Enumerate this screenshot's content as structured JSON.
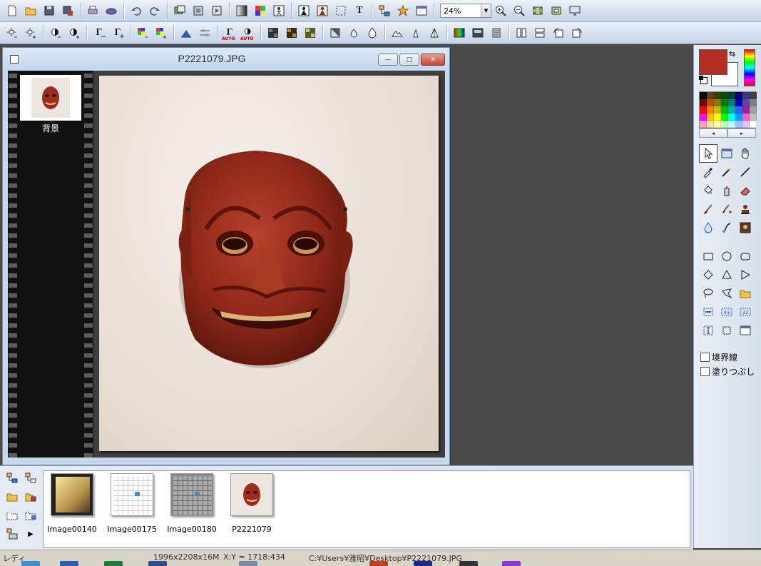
{
  "toolbar_main": {
    "zoom_value": "24%",
    "text_tool_label": "T",
    "buttons": [
      "new-file",
      "open-file",
      "save-file",
      "save-as",
      "print",
      "scan",
      "undo",
      "redo",
      "copy-image",
      "paste-image",
      "paste-new",
      "gradient",
      "color-balance",
      "figure",
      "select-person",
      "person-cut",
      "select-rect",
      "text",
      "tree",
      "effects",
      "window-mode"
    ]
  },
  "toolbar_adjust": {
    "gamma_label": "Γ",
    "auto_label": "AUTO"
  },
  "image_window": {
    "title": "P2221079.JPG",
    "min_label": "—",
    "max_label": "□",
    "close_label": "✕",
    "layer_name": "背景"
  },
  "tool_panel": {
    "foreground_color": "#b22f22",
    "background_color": "#ffffff",
    "palette": [
      "#000000",
      "#6b3b1c",
      "#3f3f00",
      "#005000",
      "#004040",
      "#000080",
      "#3a3a8a",
      "#404040",
      "#7f0000",
      "#c05000",
      "#7f7f00",
      "#008000",
      "#008080",
      "#0000c0",
      "#6b3fa0",
      "#808080",
      "#ff0000",
      "#ff8000",
      "#c0c000",
      "#00c000",
      "#00b0b0",
      "#3060ff",
      "#a020a0",
      "#a0a0a0",
      "#ff00ff",
      "#ffc000",
      "#ffff00",
      "#00ff00",
      "#00ffff",
      "#00a0ff",
      "#ff60c0",
      "#c0c0c0",
      "#ffa0c0",
      "#ffe0a0",
      "#ffffa0",
      "#c0ffc0",
      "#c0ffff",
      "#a0c0ff",
      "#e0c0ff",
      "#ffffff"
    ],
    "scroll_left": "◂",
    "scroll_right": "▸",
    "checkbox_border": "境界線",
    "checkbox_fill": "塗りつぶし"
  },
  "browser": {
    "more_arrow": "▶",
    "thumbnails": [
      {
        "caption": "Image00140"
      },
      {
        "caption": "Image00175"
      },
      {
        "caption": "Image00180"
      },
      {
        "caption": "P2221079"
      }
    ]
  },
  "status_bar": {
    "ready": "レディ",
    "size": "1996x2208x16M",
    "coords": "X:Y = 1718:434",
    "path": "C:¥Users¥雅昭¥Desktop¥P2221079.JPG"
  }
}
